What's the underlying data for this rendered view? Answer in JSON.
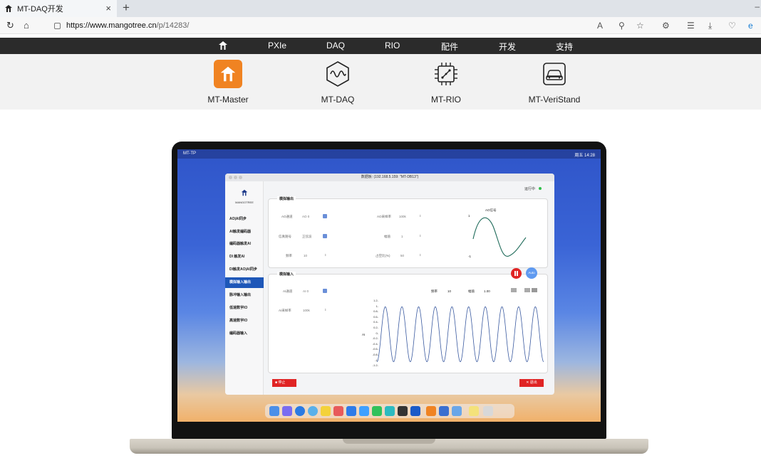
{
  "browser": {
    "tab_title": "MT-DAQ开发",
    "tab_close": "×",
    "new_tab": "+",
    "url_host": "https://www.mangotree.cn",
    "url_path": "/p/14283/"
  },
  "site_nav": {
    "items": [
      "PXIe",
      "DAQ",
      "RIO",
      "配件",
      "开发",
      "支持"
    ]
  },
  "products": [
    {
      "label": "MT-Master",
      "icon": "mangotree-logo-icon"
    },
    {
      "label": "MT-DAQ",
      "icon": "wave-hexagon-icon"
    },
    {
      "label": "MT-RIO",
      "icon": "chip-icon"
    },
    {
      "label": "MT-VeriStand",
      "icon": "car-icon"
    }
  ],
  "mac": {
    "app_name": "MT-TP",
    "clock": "周五 14:28"
  },
  "app": {
    "window_title": "数据板: (192.168.5.159: \"MT-DB13\")",
    "brand": "MANGOTREE",
    "status": "运行中",
    "sidebar": [
      "AO|AI同步",
      "AI触发编码器",
      "编码器触发AI",
      "DI 触发AI",
      "DI触发AO|AI同步",
      "模拟输入输出",
      "脉冲输入输出",
      "低速数字IO",
      "高速数字IO",
      "编码器输入"
    ],
    "active_index": 5,
    "ao": {
      "title": "模拟输出",
      "channel_label": "AO通道",
      "channel_value": "AO 0",
      "signal_label": "信真随号",
      "signal_value": "正弦波",
      "freq_label": "频率",
      "freq_value": "10",
      "rate_label": "AO采样率",
      "rate_value": "100k",
      "amp_label": "幅值",
      "amp_value": "1",
      "duty_label": "占空比(%)",
      "duty_value": "50",
      "plot_title": "AO信号",
      "plot_ymax": "1",
      "plot_ymin": "-1"
    },
    "ai": {
      "title": "模拟输入",
      "channel_label": "AI通道",
      "channel_value": "AI 0",
      "rate_label": "AI采样率",
      "rate_value": "100k",
      "freq_label": "频率",
      "freq_value": "10",
      "amp_label": "幅值",
      "amp_value": "1.00",
      "auto_label": "Auto",
      "ylabel": "AI",
      "yticks": [
        "1.2",
        "1",
        "0.8",
        "0.6",
        "0.4",
        "0.2",
        "0",
        "-0.2",
        "-0.4",
        "-0.6",
        "-0.8",
        "-1",
        "-1.2"
      ]
    },
    "stop_label": "停止",
    "exit_label": "退出"
  },
  "colors": {
    "accent_red": "#e02424",
    "sidebar_active": "#1e57b8",
    "status_green": "#2fbf4a",
    "wave_ao": "#1f6b5a",
    "wave_ai": "#3a5aa0",
    "brand_orange": "#f08322"
  }
}
